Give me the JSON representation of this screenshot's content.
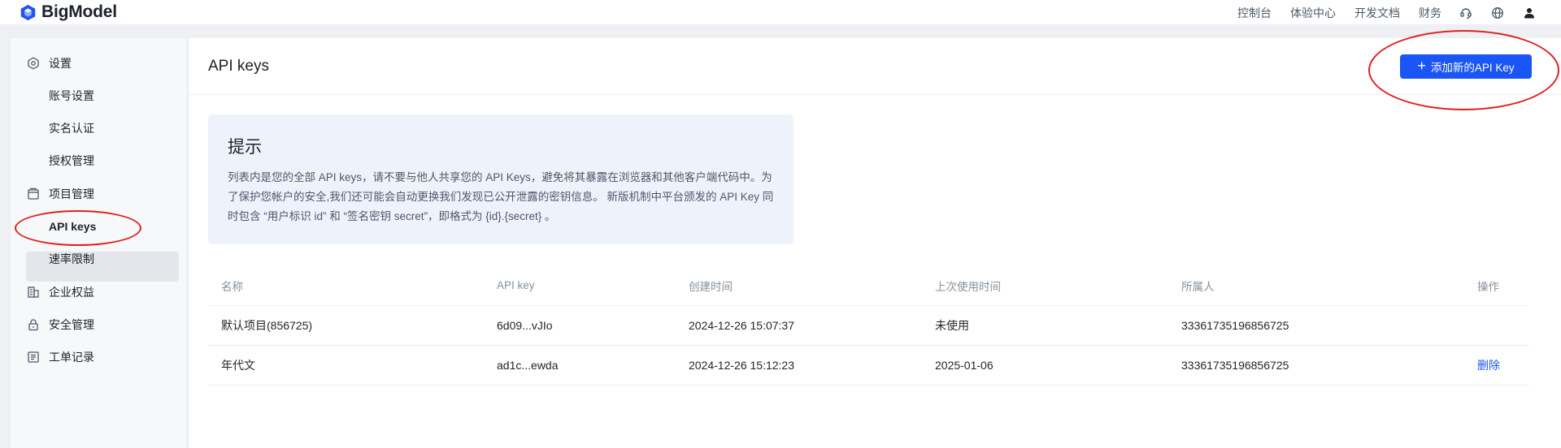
{
  "header": {
    "brand": "BigModel",
    "nav": [
      "控制台",
      "体验中心",
      "开发文档",
      "财务"
    ],
    "icons": [
      "support-icon",
      "globe-icon",
      "user-icon"
    ]
  },
  "sidebar": {
    "groups": [
      {
        "label": "设置",
        "icon": "settings-icon"
      },
      {
        "label": "项目管理",
        "icon": "project-icon"
      },
      {
        "label": "企业权益",
        "icon": "enterprise-icon"
      },
      {
        "label": "安全管理",
        "icon": "lock-icon"
      },
      {
        "label": "工单记录",
        "icon": "ticket-icon"
      }
    ],
    "settings_items": [
      "账号设置",
      "实名认证",
      "授权管理"
    ],
    "project_items": [
      "API keys",
      "速率限制"
    ],
    "active_item": "API keys"
  },
  "page": {
    "title": "API keys",
    "add_button": "添加新的API Key"
  },
  "tip": {
    "title": "提示",
    "body": "列表内是您的全部 API keys，请不要与他人共享您的 API Keys，避免将其暴露在浏览器和其他客户端代码中。为了保护您帐户的安全,我们还可能会自动更换我们发现已公开泄露的密钥信息。 新版机制中平台颁发的 API Key 同时包含 “用户标识 id” 和 “签名密钥 secret”，即格式为 {id}.{secret} 。"
  },
  "table": {
    "columns": [
      "名称",
      "API key",
      "创建时间",
      "上次使用时间",
      "所属人",
      "操作"
    ],
    "rows": [
      {
        "name": "默认项目(856725)",
        "key": "6d09...vJIo",
        "created": "2024-12-26 15:07:37",
        "last_used": "未使用",
        "owner": "33361735196856725",
        "action": ""
      },
      {
        "name": "年代文",
        "key": "ad1c...ewda",
        "created": "2024-12-26 15:12:23",
        "last_used": "2025-01-06",
        "owner": "33361735196856725",
        "action": "删除"
      }
    ]
  },
  "colors": {
    "accent": "#1a55f5",
    "annotation": "#e0201c",
    "tip_bg": "#eef2fb"
  }
}
